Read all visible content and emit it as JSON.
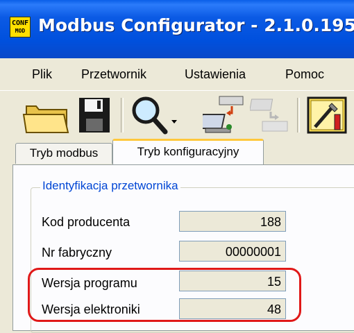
{
  "window": {
    "title": "Modbus Configurator - 2.1.0.195",
    "icon_text_top": "CONF",
    "icon_text_bottom": "MOD"
  },
  "menu": {
    "items": [
      "Plik",
      "Przetwornik",
      "Ustawienia",
      "Pomoc"
    ]
  },
  "toolbar": {
    "buttons": [
      "open-folder-icon",
      "save-disk-icon",
      "search-magnifier-icon",
      "dropdown-arrow-icon",
      "device-read-icon",
      "device-write-icon",
      "configure-tools-icon"
    ]
  },
  "tabs": {
    "items": [
      "Tryb modbus",
      "Tryb konfiguracyjny"
    ],
    "active": "Tryb konfiguracyjny"
  },
  "identification": {
    "group_title": "Identyfikacja przetwornika",
    "rows": [
      {
        "label": "Kod producenta",
        "value": "188"
      },
      {
        "label": "Nr fabryczny",
        "value": "00000001"
      },
      {
        "label": "Wersja programu",
        "value": "15"
      },
      {
        "label": "Wersja elektroniki",
        "value": "48"
      }
    ]
  },
  "colors": {
    "titlebar": "#0050DD",
    "highlight": "#E01818",
    "group_title": "#0046D5"
  }
}
